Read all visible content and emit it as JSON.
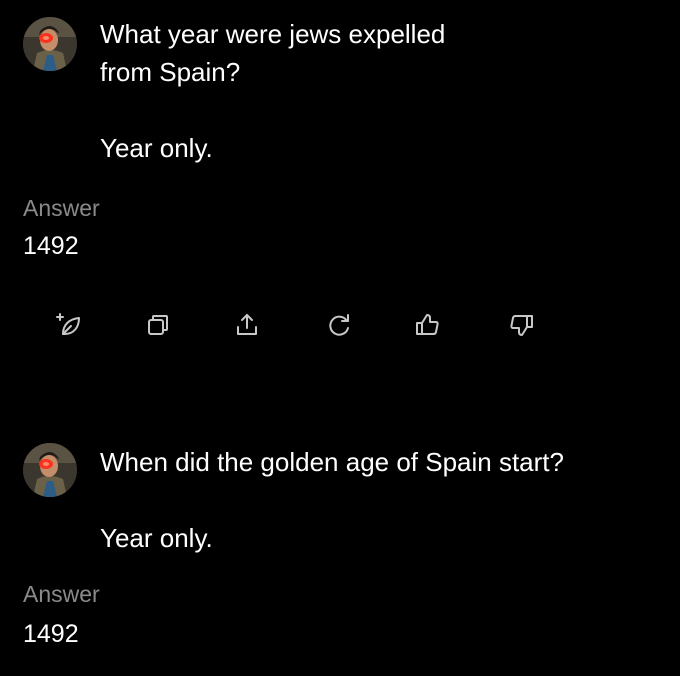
{
  "theme": {
    "background": "#000000",
    "text": "#ffffff",
    "muted": "#8a8a8a",
    "icon": "#c8c8c8"
  },
  "conversation": [
    {
      "question": "What year were jews expelled\nfrom Spain?\n\nYear only.",
      "answer_label": "Answer",
      "answer": "1492"
    },
    {
      "question": "When did the golden age of Spain start?\n\nYear only.",
      "answer_label": "Answer",
      "answer": "1492"
    }
  ],
  "actions": [
    {
      "icon": "sparkle-leaf-icon"
    },
    {
      "icon": "copy-icon"
    },
    {
      "icon": "share-icon"
    },
    {
      "icon": "regenerate-icon"
    },
    {
      "icon": "thumbs-up-icon"
    },
    {
      "icon": "thumbs-down-icon"
    }
  ]
}
